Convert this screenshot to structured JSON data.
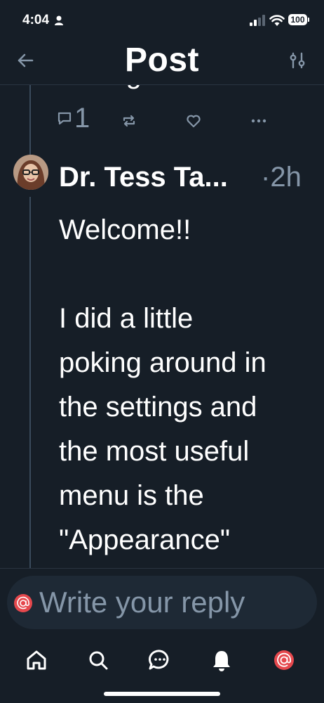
{
  "status_bar": {
    "time": "4:04",
    "battery": "100"
  },
  "header": {
    "title": "Post",
    "icons": [
      "back-arrow-icon",
      "filter-icon"
    ]
  },
  "previous_post": {
    "partial_text": "settings.",
    "reply_count": "1",
    "actions": [
      "reply-icon",
      "repost-icon",
      "like-icon",
      "more-icon"
    ]
  },
  "post": {
    "author": "Dr. Tess Ta...",
    "time": "·2h",
    "body": "Welcome!!\n\nI did a little\npoking around in\nthe settings and\nthe most useful\nmenu is the\n\"Appearance\""
  },
  "composer": {
    "placeholder": "Write your reply"
  },
  "tab_bar": {
    "items": [
      "home-icon",
      "search-icon",
      "chat-icon",
      "notifications-icon",
      "profile-avatar"
    ],
    "accent": "#e5484d"
  },
  "colors": {
    "background": "#161e27",
    "muted": "#8596a8"
  }
}
